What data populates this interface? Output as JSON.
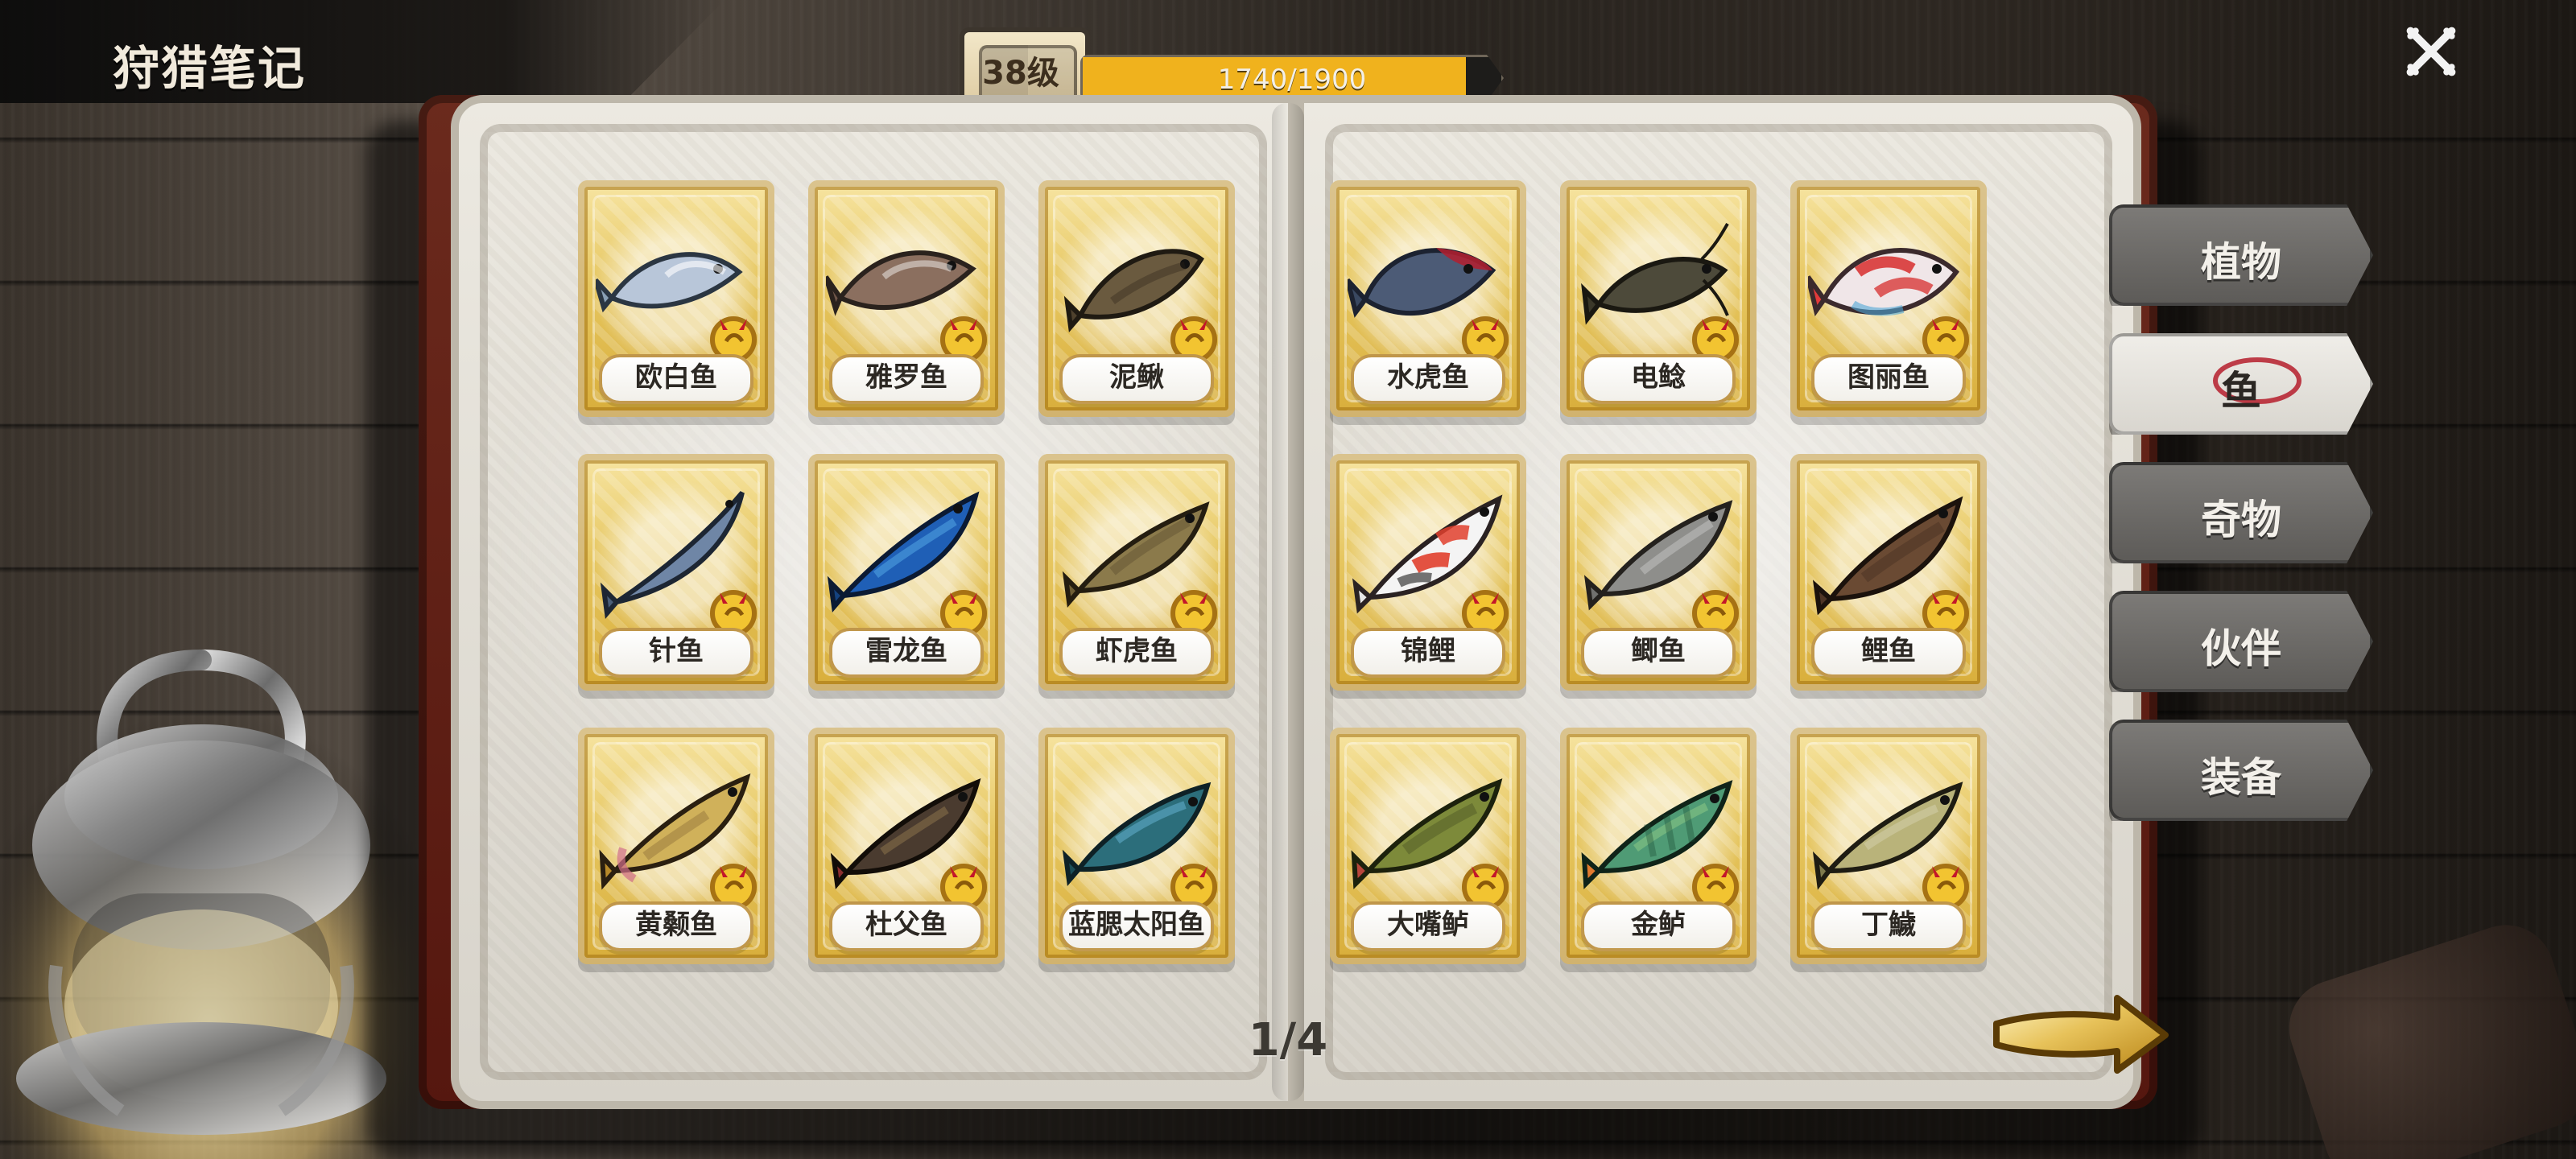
{
  "header": {
    "title": "狩猎笔记",
    "level_text": "38级",
    "xp_current": 1740,
    "xp_max": 1900,
    "xp_text": "1740/1900"
  },
  "categories": [
    {
      "label": "植物",
      "active": false
    },
    {
      "label": "鱼",
      "active": true
    },
    {
      "label": "奇物",
      "active": false
    },
    {
      "label": "伙伴",
      "active": false
    },
    {
      "label": "装备",
      "active": false
    }
  ],
  "pager": {
    "page_text": "1/4"
  },
  "fish": [
    {
      "name": "欧白鱼",
      "icon": "fish-icon"
    },
    {
      "name": "雅罗鱼",
      "icon": "fish-icon"
    },
    {
      "name": "泥鳅",
      "icon": "fish-icon"
    },
    {
      "name": "水虎鱼",
      "icon": "fish-icon"
    },
    {
      "name": "电鲶",
      "icon": "fish-icon"
    },
    {
      "name": "图丽鱼",
      "icon": "fish-icon"
    },
    {
      "name": "针鱼",
      "icon": "fish-icon"
    },
    {
      "name": "雷龙鱼",
      "icon": "fish-icon"
    },
    {
      "name": "虾虎鱼",
      "icon": "fish-icon"
    },
    {
      "name": "锦鲤",
      "icon": "fish-icon"
    },
    {
      "name": "鲫鱼",
      "icon": "fish-icon"
    },
    {
      "name": "鲤鱼",
      "icon": "fish-icon"
    },
    {
      "name": "黄颡鱼",
      "icon": "fish-icon"
    },
    {
      "name": "杜父鱼",
      "icon": "fish-icon"
    },
    {
      "name": "蓝腮太阳鱼",
      "icon": "fish-icon"
    },
    {
      "name": "大嘴鲈",
      "icon": "fish-icon"
    },
    {
      "name": "金鲈",
      "icon": "fish-icon"
    },
    {
      "name": "丁鱥",
      "icon": "fish-icon"
    }
  ],
  "colors": {
    "xp_fill": "#f0b21d",
    "tab_bg": "#6b6966",
    "tab_active_bg": "#e9e6e0",
    "card_gold": "#e7c25b"
  }
}
